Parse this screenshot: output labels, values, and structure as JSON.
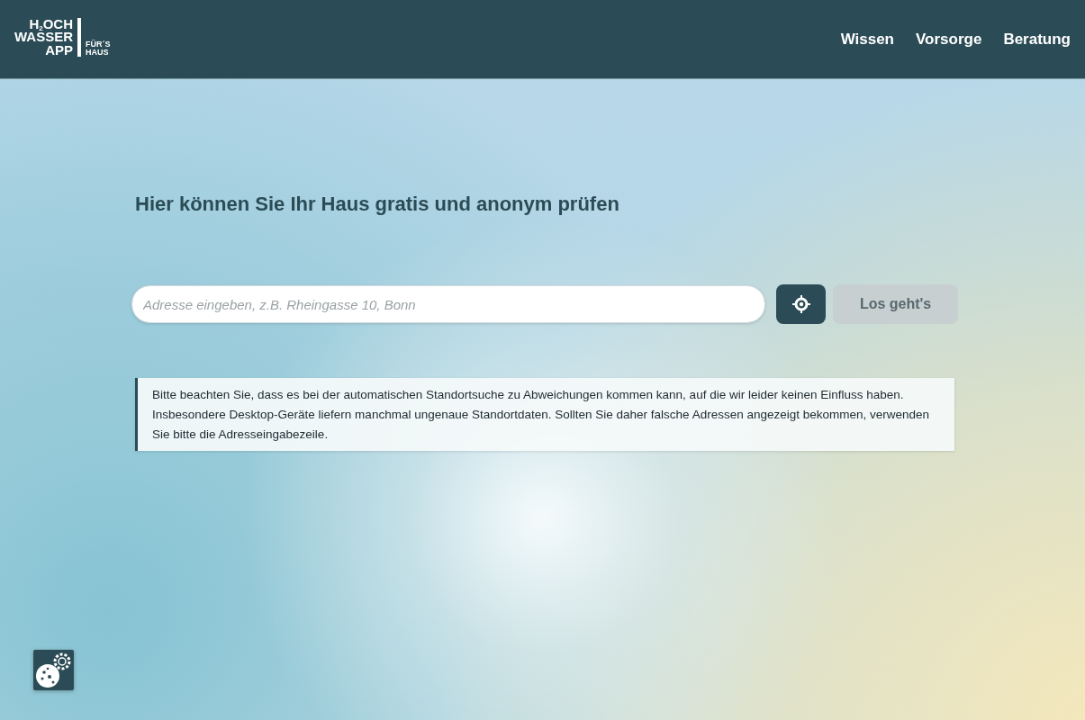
{
  "logo": {
    "lines": [
      "H$_{2}$OCH",
      "WASSER",
      "APP"
    ],
    "tagline": [
      "FÜR´S",
      "HAUS"
    ]
  },
  "nav": [
    {
      "label": "Wissen"
    },
    {
      "label": "Vorsorge"
    },
    {
      "label": "Beratung"
    }
  ],
  "heading": "Hier können Sie Ihr Haus gratis und anonym prüfen",
  "search": {
    "placeholder": "Adresse eingeben, z.B. Rheingasse 10, Bonn"
  },
  "submit": {
    "label": "Los geht's",
    "disabled": true
  },
  "notice": "Bitte beachten Sie, dass es bei der automatischen Standortsuche zu Abweichungen kommen kann, auf die wir leider keinen Einfluss haben. Insbesondere Desktop-Geräte liefern manchmal ungenaue Standortdaten. Sollten Sie daher falsche Adressen angezeigt bekommen, verwenden Sie bitte die Adresseingabezeile."
}
